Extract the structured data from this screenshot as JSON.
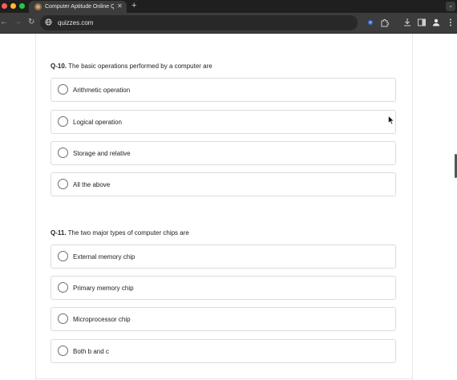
{
  "browser": {
    "tab_title": "Computer Aptitude Online Q",
    "tab_close": "✕",
    "new_tab": "+",
    "tab_menu": "⌄",
    "url": "quizzes.com",
    "colors": {
      "close_dot": "#ff5f57",
      "minimize_dot": "#febc2e",
      "zoom_dot": "#28c840"
    }
  },
  "toolbar": {
    "icons": [
      "back-arrow-icon",
      "forward-arrow-icon",
      "reload-icon",
      "site-info-icon",
      "extension-icon",
      "puzzle-icon",
      "download-icon",
      "side-panel-icon",
      "profile-icon",
      "more-menu-icon"
    ]
  },
  "questions": [
    {
      "number": "Q-10.",
      "text": " The basic operations performed by a computer are",
      "options": [
        "Arithmetic operation",
        "Logical operation",
        "Storage and relative",
        "All the above"
      ]
    },
    {
      "number": "Q-11.",
      "text": " The two major types of computer chips are",
      "options": [
        "External memory chip",
        "Primary memory chip",
        "Microprocessor chip",
        "Both b and c"
      ]
    }
  ]
}
